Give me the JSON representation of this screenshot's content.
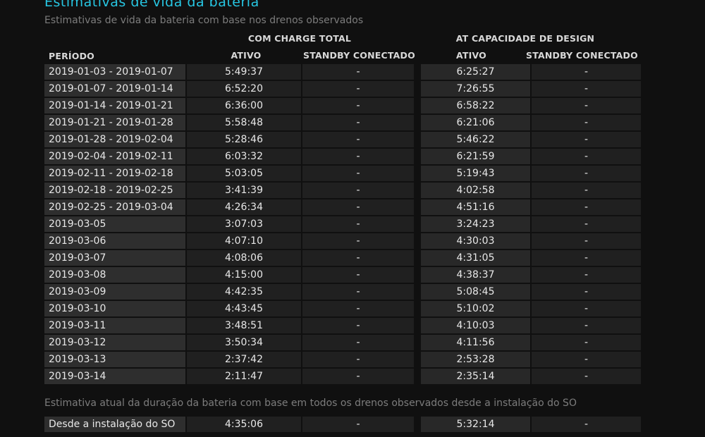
{
  "title": "Estimativas de vida da bateria",
  "subtitle": "Estimativas de vida da bateria com base nos drenos observados",
  "headers": {
    "group_full": "COM CHARGE TOTAL",
    "group_design": "AT CAPACIDADE DE DESIGN",
    "period": "PERÍODO",
    "active_full": "ATIVO",
    "standby_full": "STANDBY CONECTADO",
    "active_design": "ATIVO",
    "standby_design": "STANDBY CONECTADO"
  },
  "rows": [
    {
      "period": "2019-01-03 - 2019-01-07",
      "active_full": "5:49:37",
      "standby_full": "-",
      "active_design": "6:25:27",
      "standby_design": "-"
    },
    {
      "period": "2019-01-07 - 2019-01-14",
      "active_full": "6:52:20",
      "standby_full": "-",
      "active_design": "7:26:55",
      "standby_design": "-"
    },
    {
      "period": "2019-01-14 - 2019-01-21",
      "active_full": "6:36:00",
      "standby_full": "-",
      "active_design": "6:58:22",
      "standby_design": "-"
    },
    {
      "period": "2019-01-21 - 2019-01-28",
      "active_full": "5:58:48",
      "standby_full": "-",
      "active_design": "6:21:06",
      "standby_design": "-"
    },
    {
      "period": "2019-01-28 - 2019-02-04",
      "active_full": "5:28:46",
      "standby_full": "-",
      "active_design": "5:46:22",
      "standby_design": "-"
    },
    {
      "period": "2019-02-04 - 2019-02-11",
      "active_full": "6:03:32",
      "standby_full": "-",
      "active_design": "6:21:59",
      "standby_design": "-"
    },
    {
      "period": "2019-02-11 - 2019-02-18",
      "active_full": "5:03:05",
      "standby_full": "-",
      "active_design": "5:19:43",
      "standby_design": "-"
    },
    {
      "period": "2019-02-18 - 2019-02-25",
      "active_full": "3:41:39",
      "standby_full": "-",
      "active_design": "4:02:58",
      "standby_design": "-"
    },
    {
      "period": "2019-02-25 - 2019-03-04",
      "active_full": "4:26:34",
      "standby_full": "-",
      "active_design": "4:51:16",
      "standby_design": "-"
    },
    {
      "period": "2019-03-05",
      "active_full": "3:07:03",
      "standby_full": "-",
      "active_design": "3:24:23",
      "standby_design": "-"
    },
    {
      "period": "2019-03-06",
      "active_full": "4:07:10",
      "standby_full": "-",
      "active_design": "4:30:03",
      "standby_design": "-"
    },
    {
      "period": "2019-03-07",
      "active_full": "4:08:06",
      "standby_full": "-",
      "active_design": "4:31:05",
      "standby_design": "-"
    },
    {
      "period": "2019-03-08",
      "active_full": "4:15:00",
      "standby_full": "-",
      "active_design": "4:38:37",
      "standby_design": "-"
    },
    {
      "period": "2019-03-09",
      "active_full": "4:42:35",
      "standby_full": "-",
      "active_design": "5:08:45",
      "standby_design": "-"
    },
    {
      "period": "2019-03-10",
      "active_full": "4:43:45",
      "standby_full": "-",
      "active_design": "5:10:02",
      "standby_design": "-"
    },
    {
      "period": "2019-03-11",
      "active_full": "3:48:51",
      "standby_full": "-",
      "active_design": "4:10:03",
      "standby_design": "-"
    },
    {
      "period": "2019-03-12",
      "active_full": "3:50:34",
      "standby_full": "-",
      "active_design": "4:11:56",
      "standby_design": "-"
    },
    {
      "period": "2019-03-13",
      "active_full": "2:37:42",
      "standby_full": "-",
      "active_design": "2:53:28",
      "standby_design": "-"
    },
    {
      "period": "2019-03-14",
      "active_full": "2:11:47",
      "standby_full": "-",
      "active_design": "2:35:14",
      "standby_design": "-"
    }
  ],
  "install_note": "Estimativa atual da duração da bateria com base em todos os drenos observados desde a instalação do SO",
  "install_row": {
    "period": "Desde a instalação do SO",
    "active_full": "4:35:06",
    "standby_full": "-",
    "active_design": "5:32:14",
    "standby_design": "-"
  },
  "colors": {
    "accent": "#27c6e2",
    "background": "#101010",
    "muted": "#7c7c7c"
  }
}
